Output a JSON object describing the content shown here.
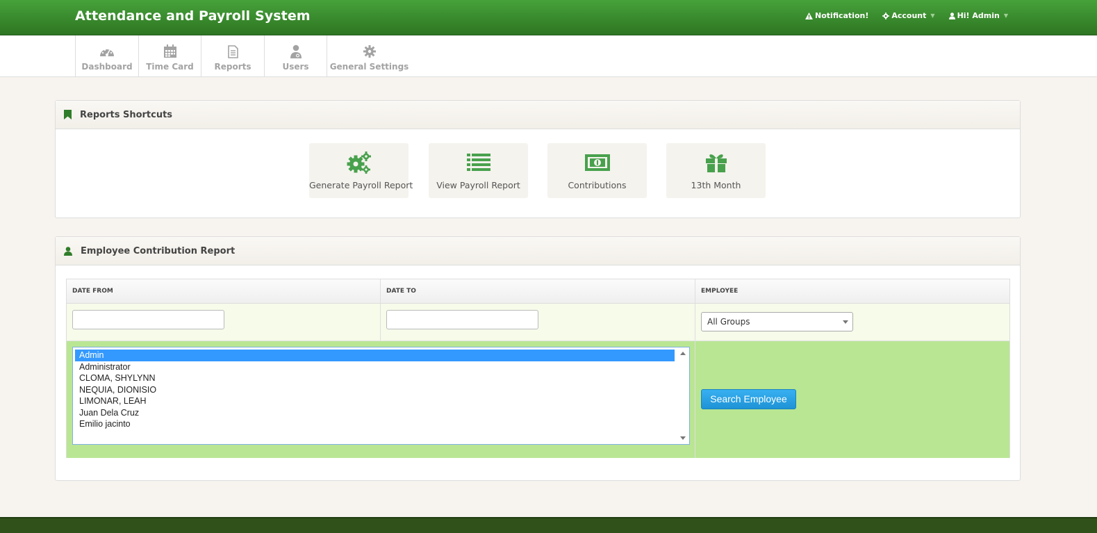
{
  "app": {
    "title": "Attendance and Payroll System"
  },
  "topnav": {
    "notification": "Notification!",
    "account": "Account",
    "user": "Hi! Admin"
  },
  "nav": {
    "dashboard": "Dashboard",
    "time_card": "Time Card",
    "reports": "Reports",
    "users": "Users",
    "general_settings": "General Settings"
  },
  "shortcuts_panel": {
    "title": "Reports Shortcuts",
    "items": [
      {
        "label": "Generate Payroll Report",
        "icon": "gears-icon"
      },
      {
        "label": "View Payroll Report",
        "icon": "list-icon"
      },
      {
        "label": "Contributions",
        "icon": "money-icon"
      },
      {
        "label": "13th Month",
        "icon": "gift-icon"
      }
    ]
  },
  "report_panel": {
    "title": "Employee Contribution Report",
    "headers": {
      "date_from": "DATE FROM",
      "date_to": "DATE TO",
      "employee": "EMPLOYEE"
    },
    "date_from_value": "",
    "date_to_value": "",
    "group_select": "All Groups",
    "employees": [
      "Admin",
      "Administrator",
      "CLOMA, SHYLYNN",
      "NEQUIA, DIONISIO",
      "LIMONAR, LEAH",
      "Juan Dela Cruz",
      "Emilio jacinto"
    ],
    "selected_employee": "Admin",
    "search_button": "Search Employee"
  },
  "colors": {
    "header_green": "#3a8c2e",
    "accent_green": "#3f9b3f",
    "row_green": "#b9e693",
    "button_blue": "#2aa3e3",
    "footer": "#30511a"
  }
}
